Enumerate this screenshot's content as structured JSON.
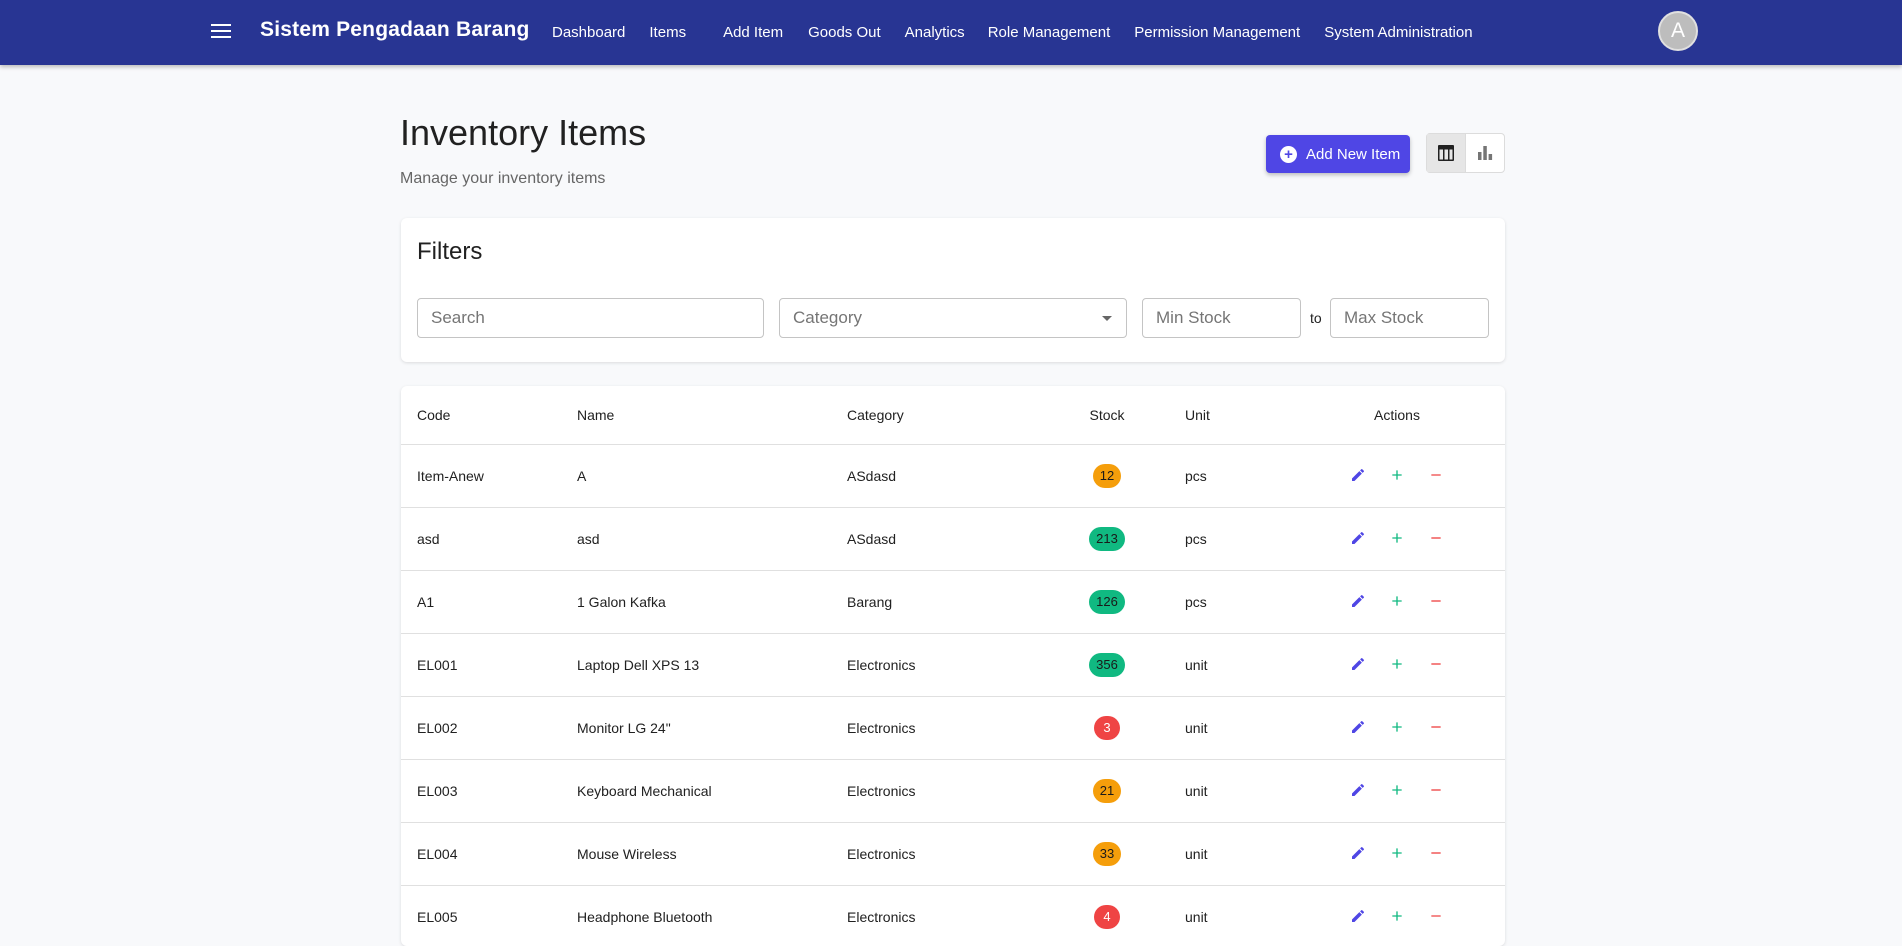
{
  "app": {
    "title": "Sistem Pengadaan Barang",
    "avatar_initial": "A"
  },
  "nav": {
    "items": [
      {
        "label": "Dashboard"
      },
      {
        "label": "Items"
      },
      {
        "label": "Add Item"
      },
      {
        "label": "Goods Out"
      },
      {
        "label": "Analytics"
      },
      {
        "label": "Role Management"
      },
      {
        "label": "Permission Management"
      },
      {
        "label": "System Administration"
      }
    ]
  },
  "page": {
    "title": "Inventory Items",
    "subtitle": "Manage your inventory items",
    "add_button_label": "Add New Item",
    "view_toggle": {
      "active": "table-view-icon",
      "other": "chart-view-icon"
    }
  },
  "filters": {
    "title": "Filters",
    "search_placeholder": "Search",
    "category_placeholder": "Category",
    "min_stock_placeholder": "Min Stock",
    "to_label": "to",
    "max_stock_placeholder": "Max Stock"
  },
  "table": {
    "columns": {
      "code": "Code",
      "name": "Name",
      "category": "Category",
      "stock": "Stock",
      "unit": "Unit",
      "actions": "Actions"
    },
    "rows": [
      {
        "code": "Item-Anew",
        "name": "A",
        "category": "ASdasd",
        "stock": "12",
        "status": "orange",
        "unit": "pcs"
      },
      {
        "code": "asd",
        "name": "asd",
        "category": "ASdasd",
        "stock": "213",
        "status": "green",
        "unit": "pcs"
      },
      {
        "code": "A1",
        "name": "1 Galon Kafka",
        "category": "Barang",
        "stock": "126",
        "status": "green",
        "unit": "pcs"
      },
      {
        "code": "EL001",
        "name": "Laptop Dell XPS 13",
        "category": "Electronics",
        "stock": "356",
        "status": "green",
        "unit": "unit"
      },
      {
        "code": "EL002",
        "name": "Monitor LG 24\"",
        "category": "Electronics",
        "stock": "3",
        "status": "red",
        "unit": "unit"
      },
      {
        "code": "EL003",
        "name": "Keyboard Mechanical",
        "category": "Electronics",
        "stock": "21",
        "status": "orange",
        "unit": "unit"
      },
      {
        "code": "EL004",
        "name": "Mouse Wireless",
        "category": "Electronics",
        "stock": "33",
        "status": "orange",
        "unit": "unit"
      },
      {
        "code": "EL005",
        "name": "Headphone Bluetooth",
        "category": "Electronics",
        "stock": "4",
        "status": "red",
        "unit": "unit"
      }
    ]
  },
  "colors": {
    "navbar": "#283593",
    "accent": "#4f46e5",
    "edit_icon": "#4f46e5",
    "add_icon": "#10b981",
    "remove_icon": "#ef4444",
    "badge_orange": "#f59e0b",
    "badge_green": "#10b981",
    "badge_red": "#ef4444"
  }
}
